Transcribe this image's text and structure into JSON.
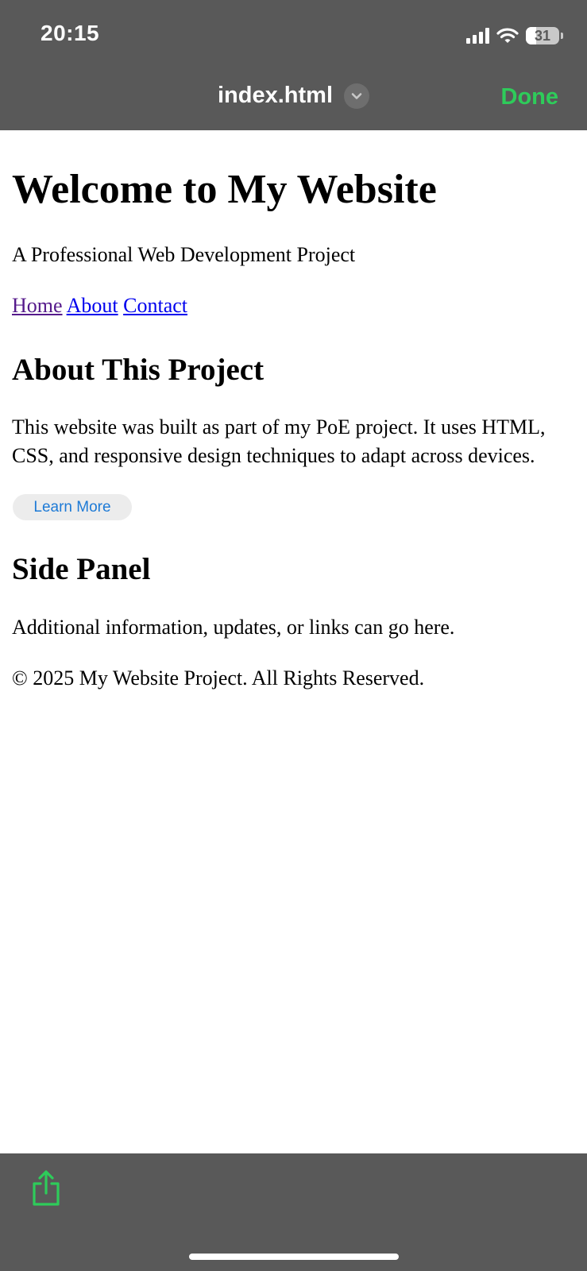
{
  "status_bar": {
    "time": "20:15",
    "battery_level": "31"
  },
  "nav": {
    "title": "index.html",
    "done_label": "Done"
  },
  "page": {
    "heading": "Welcome to My Website",
    "tagline": "A Professional Web Development Project",
    "links": [
      "Home",
      "About",
      "Contact"
    ],
    "about": {
      "heading": "About This Project",
      "text": "This website was built as part of my PoE project. It uses HTML, CSS, and responsive design techniques to adapt across devices.",
      "button_label": "Learn More"
    },
    "side_panel": {
      "heading": "Side Panel",
      "text": "Additional information, updates, or links can go here."
    },
    "footer": "© 2025 My Website Project. All Rights Reserved."
  },
  "colors": {
    "bar_background": "#595959",
    "accent_green": "#2ecc5a",
    "link_blue": "#0000ee",
    "link_visited": "#551a8b",
    "button_text_blue": "#1d7ad6"
  },
  "icons": {
    "chevron": "chevron-down-icon",
    "share": "share-icon",
    "wifi": "wifi-icon",
    "signal": "cellular-signal-icon",
    "battery": "battery-icon"
  }
}
